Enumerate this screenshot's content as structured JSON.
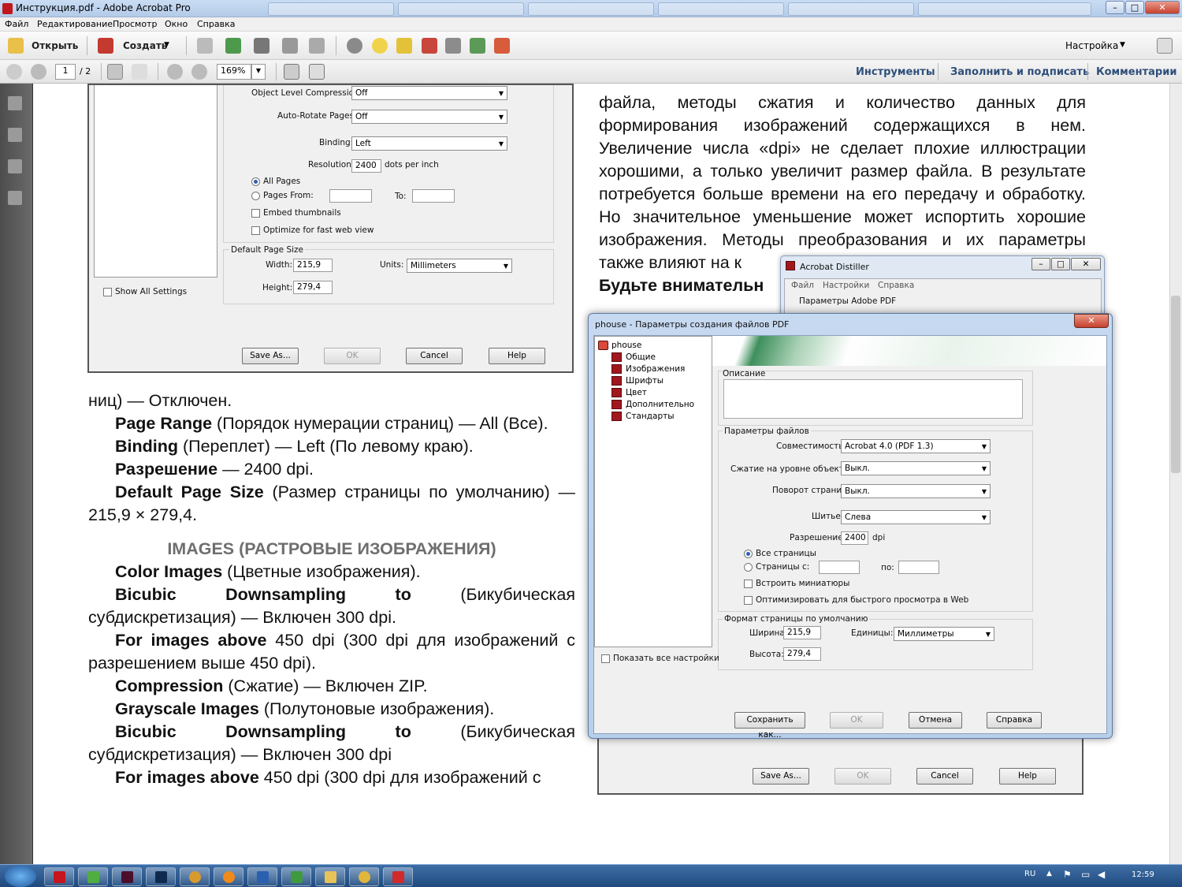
{
  "window": {
    "title": "Инструкция.pdf - Adobe Acrobat Pro",
    "min": "–",
    "max": "□",
    "close": "✕"
  },
  "menu": [
    "Файл",
    "Редактирование",
    "Просмотр",
    "Окно",
    "Справка"
  ],
  "toolbar": {
    "open": "Открыть",
    "create": "Создать",
    "customize": "Настройка"
  },
  "nav": {
    "page": "1",
    "page_total": "/ 2",
    "zoom": "169%"
  },
  "right_links": {
    "tools": "Инструменты",
    "sign": "Заполнить и подписать",
    "comments": "Комментарии"
  },
  "left_shot": {
    "olc_label": "Object Level Compression:",
    "olc_value": "Off",
    "ar_label": "Auto-Rotate Pages:",
    "ar_value": "Off",
    "binding_label": "Binding:",
    "binding_value": "Left",
    "res_label": "Resolution:",
    "res_value": "2400",
    "res_unit": "dots per inch",
    "all_pages": "All Pages",
    "pages_from": "Pages From:",
    "to": "To:",
    "embed": "Embed thumbnails",
    "optimize": "Optimize for fast web view",
    "dps": "Default Page Size",
    "width_label": "Width:",
    "width_value": "215,9",
    "units_label": "Units:",
    "units_value": "Millimeters",
    "height_label": "Height:",
    "height_value": "279,4",
    "show_all": "Show All Settings",
    "save": "Save As...",
    "ok": "OK",
    "cancel": "Cancel",
    "help": "Help"
  },
  "body": {
    "l1": "ниц) — Отключен.",
    "pr_b": "Page Range",
    "pr": " (Порядок нумерации страниц) — All (Все).",
    "bi_b": "Binding",
    "bi": " (Переплет) — Left (По левому краю).",
    "re_b": "Разрешение",
    "re": " — 2400 dpi.",
    "dp_b": "Default Page Size",
    "dp": " (Размер страницы по умолчанию) — 215,9 × 279,4.",
    "heading": "IMAGES (РАСТРОВЫЕ ИЗОБРАЖЕНИЯ)",
    "ci_b": "Color Images",
    "ci": " (Цветные изображения).",
    "bd1_b": "Bicubic Downsampling to",
    "bd1": " (Бикубическая субдискретизация) — Включен 300 dpi.",
    "fi1_b": "For images above",
    "fi1": " 450 dpi (300 dpi для изображений с разрешением выше 450 dpi).",
    "co_b": "Compression",
    "co": " (Сжатие) — Включен ZIP.",
    "gi_b": "Grayscale Images",
    "gi": " (Полутоновые изображения).",
    "bd2_b": "Bicubic Downsampling to",
    "bd2": " (Бикубическая субдискретизация) — Включен 300 dpi",
    "fi2_b": "For images above",
    "fi2": " 450 dpi (300 dpi для изображений с"
  },
  "right_text": {
    "p": "файла, методы сжатия и количество данных для формирования изображений содержащихся в нем. Увеличение числа «dpi» не сделает плохие иллюстрации хорошими, а только увеличит размер файла. В результате потребуется больше времени на его передачу и обработку. Но значительное уменьшение может испортить хорошие изображения. Методы преобразования и их параметры также влияют на к",
    "bold": "Будьте внимательн"
  },
  "distiller": {
    "title": "Acrobat Distiller",
    "menu": [
      "Файл",
      "Настройки",
      "Справка"
    ],
    "params": "Параметры Adobe PDF"
  },
  "dialog": {
    "title": "phouse - Параметры создания файлов PDF",
    "tree_root": "phouse",
    "tree": [
      "Общие",
      "Изображения",
      "Шрифты",
      "Цвет",
      "Дополнительно",
      "Стандарты"
    ],
    "desc": "Описание",
    "file_params": "Параметры файлов",
    "compat_label": "Совместимость:",
    "compat_value": "Acrobat 4.0 (PDF 1.3)",
    "comp_label": "Сжатие на уровне объектов:",
    "comp_value": "Выкл.",
    "rot_label": "Поворот страниц:",
    "rot_value": "Выкл.",
    "bind_label": "Шитье:",
    "bind_value": "Слева",
    "res_label": "Разрешение:",
    "res_value": "2400",
    "res_unit": "dpi",
    "all_pages": "Все страницы",
    "pages_from": "Страницы с:",
    "to": "по:",
    "thumbs": "Встроить миниатюры",
    "web": "Оптимизировать для быстрого просмотра в Web",
    "page_fmt": "Формат страницы по умолчанию",
    "width_label": "Ширина:",
    "width_value": "215,9",
    "units_label": "Единицы:",
    "units_value": "Миллиметры",
    "height_label": "Высота:",
    "height_value": "279,4",
    "show_all": "Показать все настройки",
    "save": "Сохранить как...",
    "ok": "OK",
    "cancel": "Отмена",
    "help": "Справка"
  },
  "bottom_shot": {
    "save": "Save As...",
    "ok": "OK",
    "cancel": "Cancel",
    "help": "Help"
  },
  "taskbar": {
    "lang": "RU",
    "time": "12:59"
  }
}
